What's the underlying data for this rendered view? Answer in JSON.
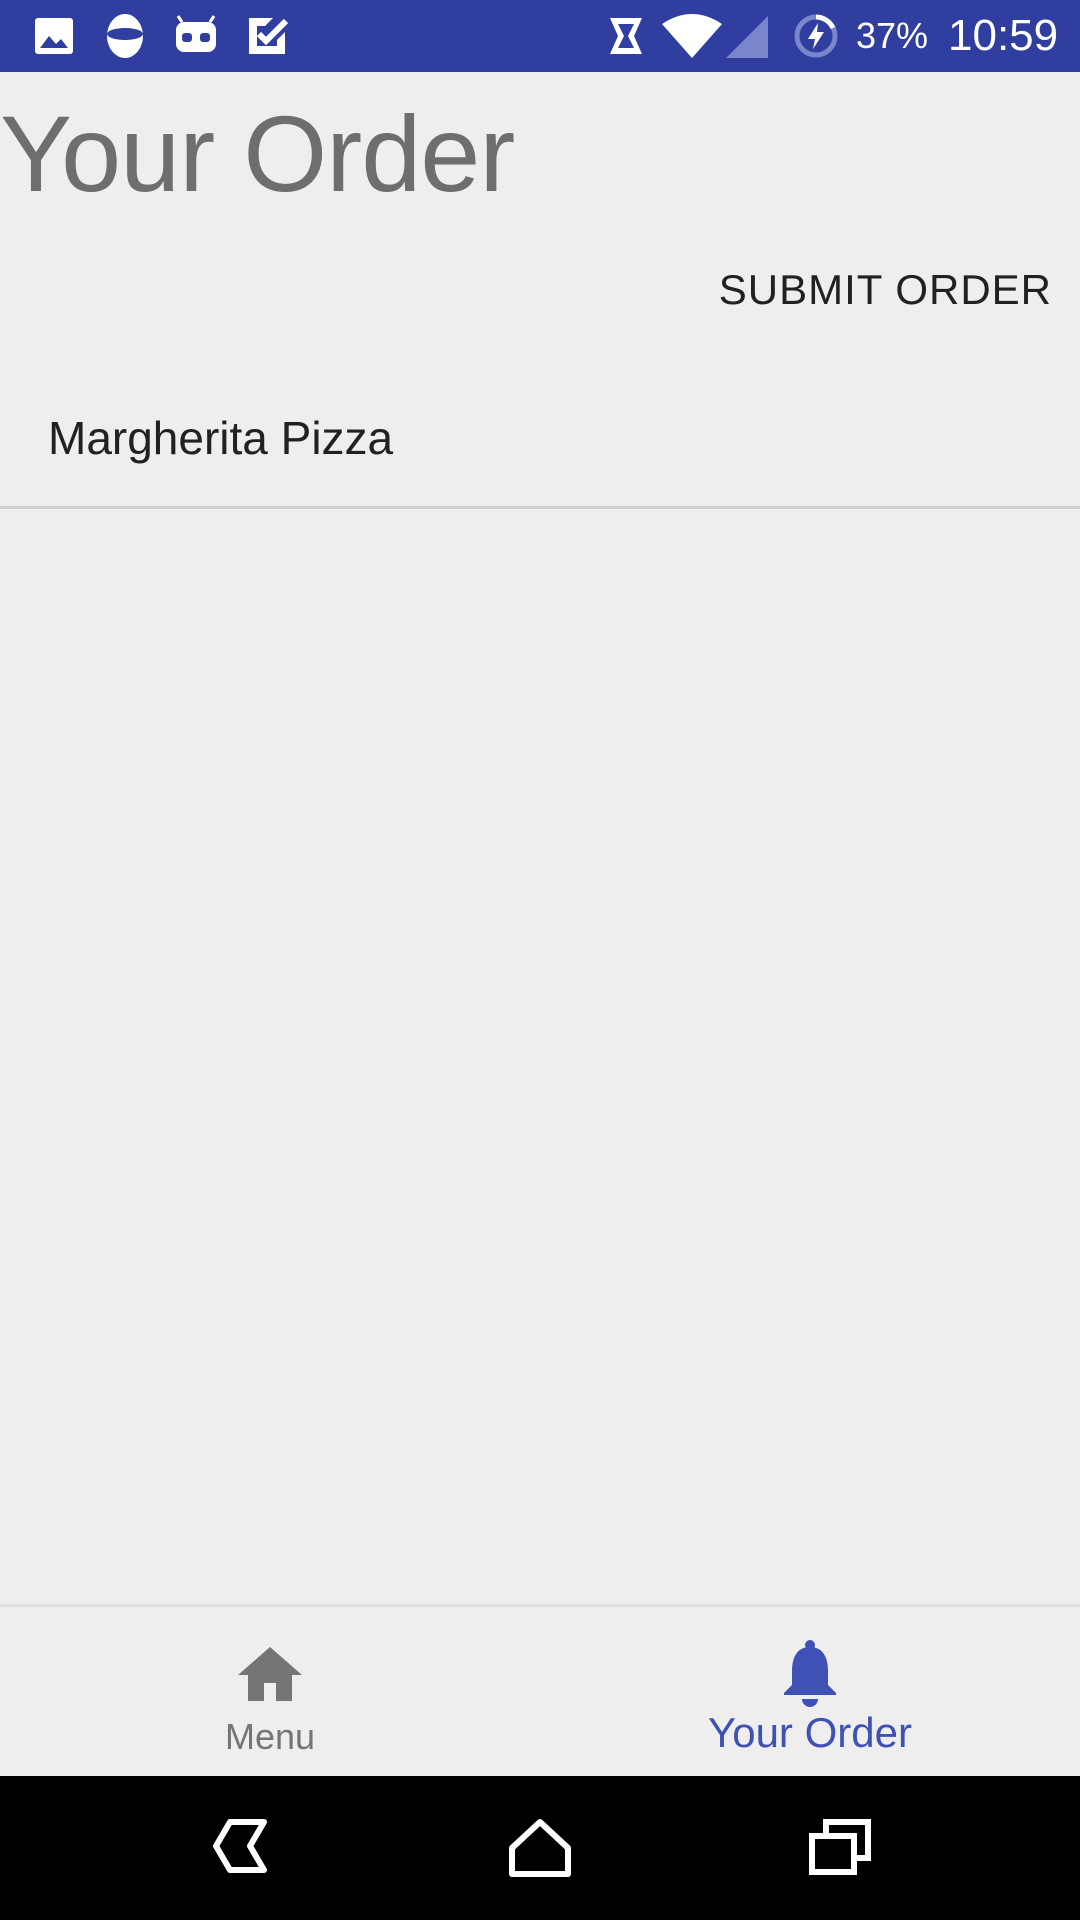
{
  "status_bar": {
    "battery_text": "37%",
    "time": "10:59",
    "color": "#303F9F",
    "left_icons": [
      "gallery-icon",
      "drive-icon",
      "android-icon",
      "tasks-icon"
    ],
    "right_icons": [
      "nfc-icon",
      "wifi-icon",
      "signal-icon",
      "battery-charging-icon"
    ]
  },
  "page": {
    "title": "Your Order",
    "submit_label": "SUBMIT ORDER"
  },
  "order": {
    "items": [
      {
        "label": "Margherita Pizza"
      }
    ]
  },
  "bottom_nav": {
    "accent_color": "#3F51B5",
    "items": [
      {
        "label": "Menu",
        "icon": "home-icon",
        "active": false
      },
      {
        "label": "Your Order",
        "icon": "bell-icon",
        "active": true
      }
    ]
  },
  "system_nav": {
    "buttons": [
      "back-icon",
      "home-nav-icon",
      "recents-icon"
    ]
  }
}
